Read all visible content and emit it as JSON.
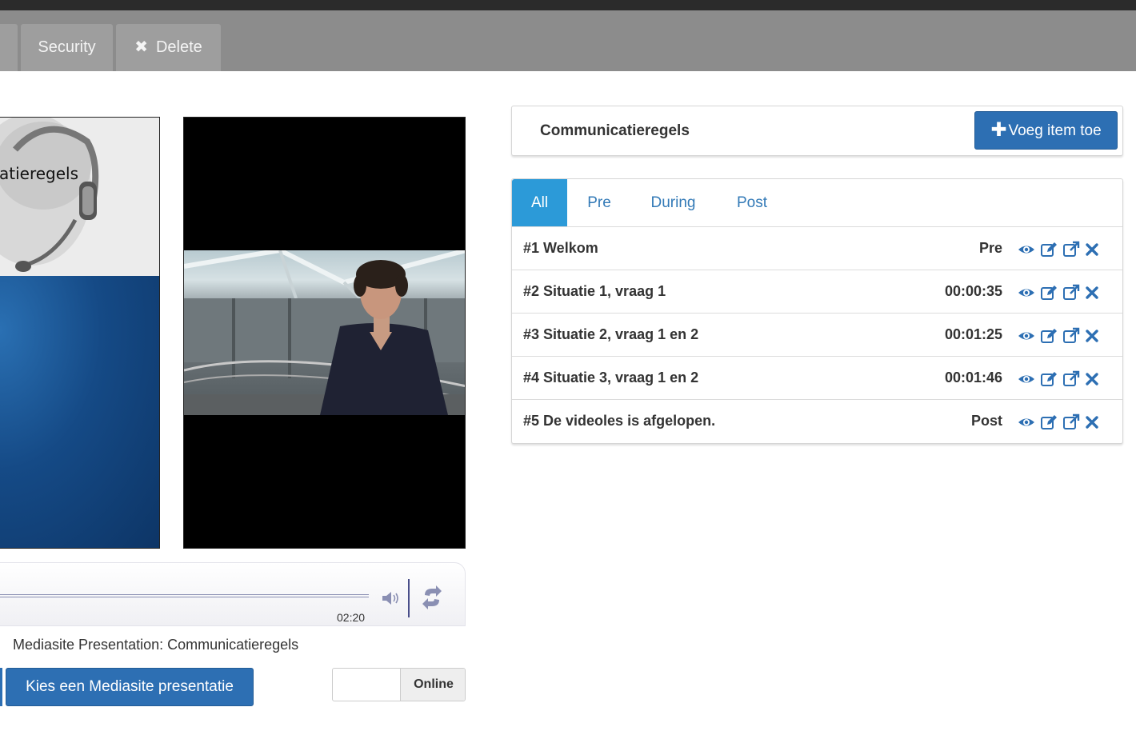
{
  "tabbar": {
    "security_label": "Security",
    "delete_label": "Delete"
  },
  "slide": {
    "title_fragment": "atieregels"
  },
  "player": {
    "time": "02:20"
  },
  "presentation": {
    "label": "Mediasite Presentation: Communicatieregels",
    "choose_label": "Kies een Mediasite presentatie",
    "toggle_label": "Online"
  },
  "panel": {
    "title": "Communicatieregels",
    "add_label": "Voeg item toe",
    "tabs": [
      {
        "label": "All"
      },
      {
        "label": "Pre"
      },
      {
        "label": "During"
      },
      {
        "label": "Post"
      }
    ],
    "items": [
      {
        "title": "#1 Welkom",
        "time": "Pre"
      },
      {
        "title": "#2 Situatie 1, vraag 1",
        "time": "00:00:35"
      },
      {
        "title": "#3 Situatie 2, vraag 1 en 2",
        "time": "00:01:25"
      },
      {
        "title": "#4 Situatie 3, vraag 1 en 2",
        "time": "00:01:46"
      },
      {
        "title": "#5 De videoles is afgelopen.",
        "time": "Post"
      }
    ]
  },
  "colors": {
    "primary": "#2d6fb3",
    "tab_active": "#2c9ad8",
    "link": "#337ab7",
    "tabbar": "#8c8c8c"
  },
  "icons": [
    "eye-icon",
    "edit-icon",
    "external-link-icon",
    "close-icon",
    "volume-icon",
    "refresh-icon"
  ]
}
